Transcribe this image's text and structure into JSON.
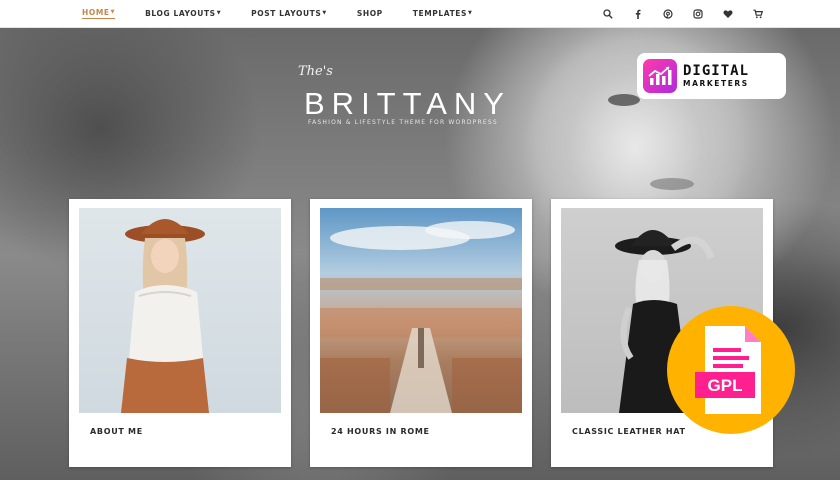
{
  "nav": {
    "items": [
      {
        "label": "HOME",
        "active": true,
        "has_dropdown": true
      },
      {
        "label": "BLOG LAYOUTS",
        "active": false,
        "has_dropdown": true
      },
      {
        "label": "POST LAYOUTS",
        "active": false,
        "has_dropdown": true
      },
      {
        "label": "SHOP",
        "active": false,
        "has_dropdown": false
      },
      {
        "label": "TEMPLATES",
        "active": false,
        "has_dropdown": true
      }
    ],
    "icons": [
      "search-icon",
      "facebook-icon",
      "pinterest-icon",
      "instagram-icon",
      "heart-icon",
      "cart-icon"
    ],
    "active_color": "#c8854b"
  },
  "brand": {
    "script": "The's",
    "title": "BRITTANY",
    "tagline": "FASHION & LIFESTYLE THEME FOR WORDPRESS"
  },
  "badge": {
    "line1": "DIGITAL",
    "line2": "MARKETERS",
    "accent": "#ff3aa8"
  },
  "cards": [
    {
      "caption": "ABOUT ME"
    },
    {
      "caption": "24 HOURS IN ROME"
    },
    {
      "caption": "CLASSIC LEATHER HAT"
    }
  ],
  "gpl": {
    "label": "GPL",
    "circle_color": "#ffb300",
    "label_color": "#ff1f8e"
  }
}
